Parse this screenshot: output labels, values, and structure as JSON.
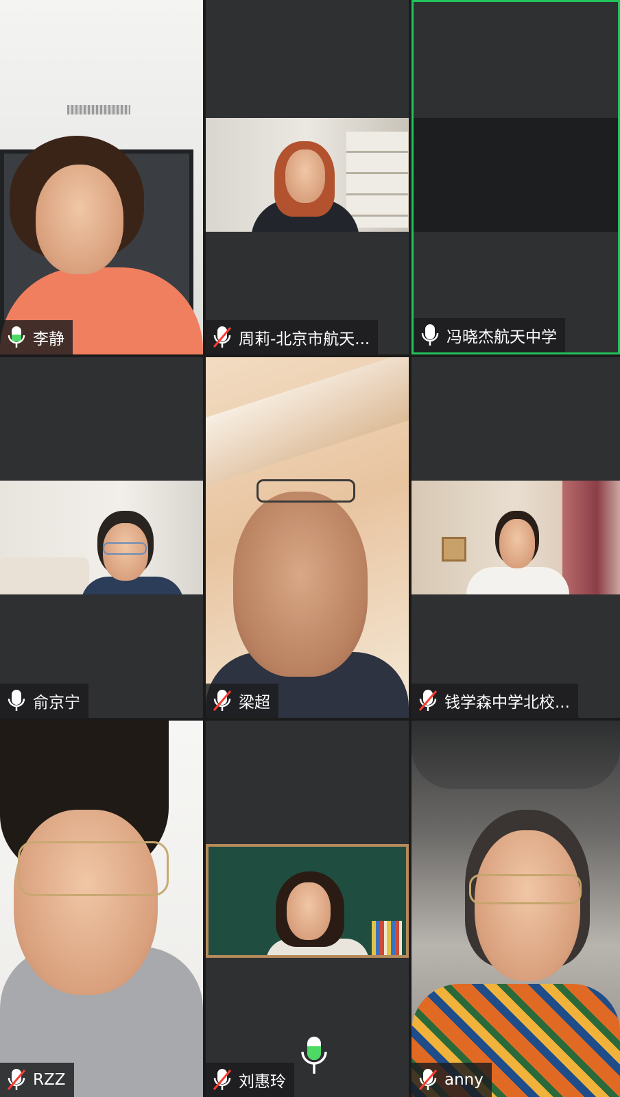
{
  "participants": [
    {
      "name": "李静",
      "mic": "on",
      "active": false
    },
    {
      "name": "周莉-北京市航天...",
      "mic": "muted",
      "active": false
    },
    {
      "name": "冯晓杰航天中学",
      "mic": "on",
      "active": true
    },
    {
      "name": "俞京宁",
      "mic": "on",
      "active": false
    },
    {
      "name": "梁超",
      "mic": "muted",
      "active": false
    },
    {
      "name": "钱学森中学北校...",
      "mic": "muted",
      "active": false
    },
    {
      "name": "RZZ",
      "mic": "muted",
      "active": false
    },
    {
      "name": "刘惠玲",
      "mic": "muted",
      "active": false
    },
    {
      "name": "anny",
      "mic": "muted",
      "active": false
    }
  ],
  "speaking_indicator": {
    "icon": "mic-speaking-icon",
    "participant": "刘惠玲"
  },
  "colors": {
    "tile_bg": "#2f3032",
    "active_border": "#22c35a",
    "mic_on_level": "#4cd964",
    "mic_muted_slash": "#ff3b30"
  }
}
